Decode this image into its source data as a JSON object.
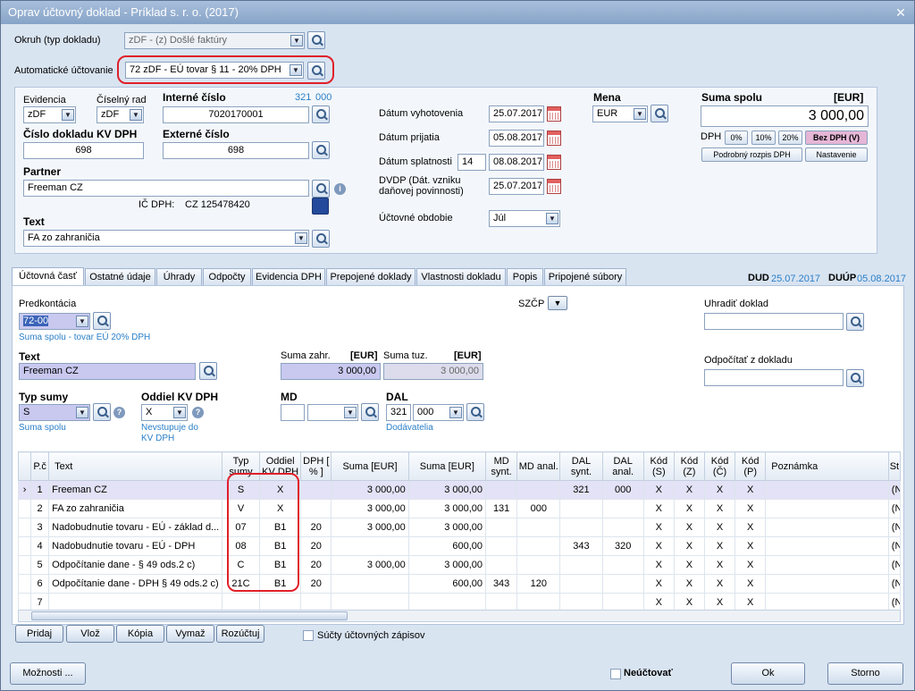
{
  "window": {
    "title": "Oprav účtovný doklad - Príklad s. r. o. (2017)",
    "close": "✕"
  },
  "header": {
    "okruh_label": "Okruh (typ dokladu)",
    "okruh_value": "zDF - (z) Došlé faktúry",
    "auto_label": "Automatické účtovanie",
    "auto_value": "72 zDF - EÚ tovar § 11 - 20% DPH"
  },
  "doc": {
    "evidencia_label": "Evidencia",
    "evidencia_value": "zDF",
    "ciselny_rad_label": "Číselný rad",
    "ciselny_rad_value": "zDF",
    "interne_cislo_label": "Interné číslo",
    "interne_cislo_value": "7020170001",
    "interne_links_a": "321",
    "interne_links_b": "000",
    "cislo_kv_label": "Číslo dokladu KV DPH",
    "cislo_kv_value": "698",
    "externe_cislo_label": "Externé číslo",
    "externe_cislo_value": "698",
    "partner_label": "Partner",
    "partner_value": "Freeman CZ",
    "ic_dph_label": "IČ DPH:",
    "ic_dph_value": "CZ 125478420",
    "text_label": "Text",
    "text_value": "FA zo zahraničia"
  },
  "dates": {
    "vyhotovenia_label": "Dátum vyhotovenia",
    "vyhotovenia_value": "25.07.2017",
    "prijatia_label": "Dátum prijatia",
    "prijatia_value": "05.08.2017",
    "splatnosti_label": "Dátum splatnosti",
    "splatnosti_days": "14",
    "splatnosti_value": "08.08.2017",
    "dvdp_label": "DVDP (Dát. vzniku daňovej povinnosti)",
    "dvdp_value": "25.07.2017",
    "obdobie_label": "Účtovné obdobie",
    "obdobie_value": "Júl"
  },
  "mena": {
    "label": "Mena",
    "value": "EUR"
  },
  "suma": {
    "label": "Suma spolu",
    "currency": "[EUR]",
    "value": "3 000,00",
    "dph_label": "DPH",
    "b0": "0%",
    "b10": "10%",
    "b20": "20%",
    "bez": "Bez DPH (V)",
    "rozpis": "Podrobný rozpis DPH",
    "nastavenie": "Nastavenie"
  },
  "tabs": [
    "Účtovná časť",
    "Ostatné údaje",
    "Úhrady",
    "Odpočty",
    "Evidencia DPH",
    "Prepojené doklady",
    "Vlastnosti dokladu",
    "Popis",
    "Pripojené súbory"
  ],
  "dud": {
    "label": "DUD",
    "value": "25.07.2017",
    "label2": "DUÚP",
    "value2": "05.08.2017"
  },
  "form": {
    "predkontacia_label": "Predkontácia",
    "predkontacia_value": "72-00",
    "predkontacia_hint": "Suma spolu - tovar EÚ 20% DPH",
    "szcp_label": "SZČP",
    "uhradit_label": "Uhradiť doklad",
    "odpocitat_label": "Odpočítať z dokladu",
    "text_label": "Text",
    "text_value": "Freeman CZ",
    "suma_zahr_label": "Suma zahr.",
    "suma_zahr_cur": "[EUR]",
    "suma_zahr_value": "3 000,00",
    "suma_tuz_label": "Suma tuz.",
    "suma_tuz_cur": "[EUR]",
    "suma_tuz_value": "3 000,00",
    "typ_sumy_label": "Typ sumy",
    "typ_sumy_value": "S",
    "typ_sumy_hint": "Suma spolu",
    "oddiel_label": "Oddiel KV DPH",
    "oddiel_value": "X",
    "oddiel_hint": "Nevstupuje do KV DPH",
    "md_label": "MD",
    "dal_label": "DAL",
    "dal_a": "321",
    "dal_b": "000",
    "dal_hint": "Dodávatelia"
  },
  "grid": {
    "headers": [
      "P.č",
      "Text",
      "Typ sumy",
      "Oddiel KV DPH",
      "DPH [ % ]",
      "Suma [EUR]",
      "Suma [EUR]",
      "MD synt.",
      "MD anal.",
      "DAL synt.",
      "DAL anal.",
      "Kód (S)",
      "Kód (Z)",
      "Kód (Č)",
      "Kód (P)",
      "Poznámka",
      "St"
    ],
    "rows": [
      [
        "1",
        "Freeman CZ",
        "S",
        "X",
        "",
        "3 000,00",
        "3 000,00",
        "",
        "",
        "321",
        "000",
        "X",
        "X",
        "X",
        "X",
        "",
        "(Ne"
      ],
      [
        "2",
        "FA zo zahraničia",
        "V",
        "X",
        "",
        "3 000,00",
        "3 000,00",
        "131",
        "000",
        "",
        "",
        "X",
        "X",
        "X",
        "X",
        "",
        "(Ne"
      ],
      [
        "3",
        "Nadobudnutie tovaru - EÚ - základ d...",
        "07",
        "B1",
        "20",
        "3 000,00",
        "3 000,00",
        "",
        "",
        "",
        "",
        "X",
        "X",
        "X",
        "X",
        "",
        "(Ne"
      ],
      [
        "4",
        "Nadobudnutie tovaru - EÚ - DPH",
        "08",
        "B1",
        "20",
        "",
        "600,00",
        "",
        "",
        "343",
        "320",
        "X",
        "X",
        "X",
        "X",
        "",
        "(Ne"
      ],
      [
        "5",
        "Odpočítanie dane - § 49 ods.2 c)",
        "C",
        "B1",
        "20",
        "3 000,00",
        "3 000,00",
        "",
        "",
        "",
        "",
        "X",
        "X",
        "X",
        "X",
        "",
        "(Ne"
      ],
      [
        "6",
        "Odpočítanie dane - DPH § 49 ods.2 c)",
        "21C",
        "B1",
        "20",
        "",
        "600,00",
        "343",
        "120",
        "",
        "",
        "X",
        "X",
        "X",
        "X",
        "",
        "(Ne"
      ],
      [
        "7",
        "",
        "",
        "",
        "",
        "",
        "",
        "",
        "",
        "",
        "",
        "X",
        "X",
        "X",
        "X",
        "",
        "(Ne"
      ]
    ]
  },
  "bottom": {
    "pridaj": "Pridaj",
    "vloz": "Vlož",
    "kopia": "Kópia",
    "vymaz": "Vymaž",
    "rozuctuj": "Rozúčtuj",
    "sucty": "Súčty účtovných zápisov",
    "moznosti": "Možnosti ...",
    "neuctovat": "Neúčtovať",
    "ok": "Ok",
    "storno": "Storno"
  }
}
